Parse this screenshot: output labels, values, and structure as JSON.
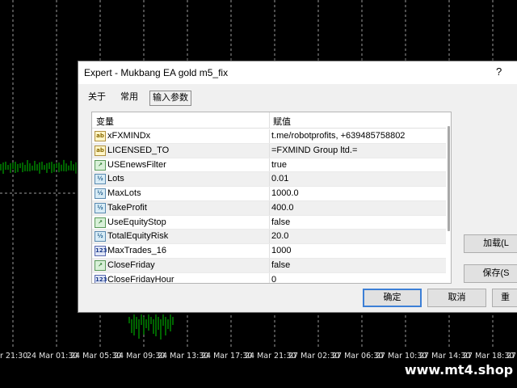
{
  "time_axis": [
    "r 21:30",
    "24 Mar 01:30",
    "24 Mar 05:30",
    "24 Mar 09:30",
    "24 Mar 13:30",
    "24 Mar 17:30",
    "24 Mar 21:30",
    "27 Mar 02:30",
    "27 Mar 06:30",
    "27 Mar 10:30",
    "27 Mar 14:30",
    "27 Mar 18:30",
    "27 M"
  ],
  "watermark": "www.mt4.shop",
  "dialog": {
    "title": "Expert - Mukbang EA gold m5_fix",
    "help": "?",
    "tabs": [
      "关于",
      "常用",
      "输入参数"
    ],
    "columns": {
      "variable": "变量",
      "value": "赋值"
    },
    "params": [
      {
        "icon": "ab",
        "icon_type": "string-icon",
        "name": "xFXMINDx",
        "value": "t.me/robotprofits, +639485758802"
      },
      {
        "icon": "ab",
        "icon_type": "string-icon",
        "name": "LICENSED_TO",
        "value": "=FXMIND Group ltd.="
      },
      {
        "icon": "↗",
        "icon_type": "bool-icon",
        "name": "USEnewsFilter",
        "value": "true"
      },
      {
        "icon": "½",
        "icon_type": "double-icon",
        "name": "Lots",
        "value": "0.01"
      },
      {
        "icon": "½",
        "icon_type": "double-icon",
        "name": "MaxLots",
        "value": "1000.0"
      },
      {
        "icon": "½",
        "icon_type": "double-icon",
        "name": "TakeProfit",
        "value": "400.0"
      },
      {
        "icon": "↗",
        "icon_type": "bool-icon",
        "name": "UseEquityStop",
        "value": "false"
      },
      {
        "icon": "½",
        "icon_type": "double-icon",
        "name": "TotalEquityRisk",
        "value": "20.0"
      },
      {
        "icon": "123",
        "icon_type": "int-icon",
        "name": "MaxTrades_16",
        "value": "1000"
      },
      {
        "icon": "↗",
        "icon_type": "bool-icon",
        "name": "CloseFriday",
        "value": "false"
      },
      {
        "icon": "123",
        "icon_type": "int-icon",
        "name": "CloseFridayHour",
        "value": "0"
      }
    ],
    "buttons": {
      "ok": "确定",
      "cancel": "取消",
      "reset": "重",
      "load": "加载(L",
      "save": "保存(S"
    }
  },
  "colors": {
    "bull_candle": "#00c800",
    "background": "#000000",
    "ok_border": "#3c7fd6"
  }
}
